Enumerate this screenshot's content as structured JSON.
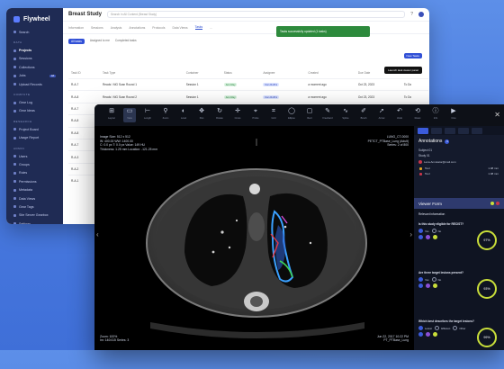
{
  "app": {
    "brand": "Flywheel",
    "study_title": "Breast Study",
    "search_placeholder": "Search in All Content (Breast Study)",
    "help": "?",
    "toast": "Tasks successfully updated (1 tasks)",
    "new_task_button": "New Tasks",
    "tooltip": "Launch task viewer panel"
  },
  "sidebar": {
    "items": [
      {
        "label": "Search"
      },
      {
        "section": "DATA"
      },
      {
        "label": "Projects",
        "active": true
      },
      {
        "label": "Sessions"
      },
      {
        "label": "Collections"
      },
      {
        "label": "Jobs",
        "badge": "18"
      },
      {
        "label": "Upload Records"
      },
      {
        "section": "COMPUTE"
      },
      {
        "label": "Gear Log"
      },
      {
        "label": "Gear Ideas"
      },
      {
        "section": "RESEARCH"
      },
      {
        "label": "Project Board"
      },
      {
        "label": "Usage Report"
      },
      {
        "section": "ADMIN"
      },
      {
        "label": "Users"
      },
      {
        "label": "Groups"
      },
      {
        "label": "Roles"
      },
      {
        "label": "Permissions"
      },
      {
        "label": "Metadata"
      },
      {
        "label": "Data Views"
      },
      {
        "label": "Gear Tags"
      },
      {
        "label": "Site Server Gearbox"
      },
      {
        "label": "Settings"
      }
    ]
  },
  "tabs": [
    "Information",
    "Sessions",
    "Analysis",
    "Annotations",
    "Protocols",
    "Data Views",
    "Tasks",
    "..."
  ],
  "active_tab": "Tasks",
  "subtabs": [
    "All tasks",
    "Assigned to me",
    "Completed tasks"
  ],
  "table": {
    "headers": [
      "Task ID",
      "Task Type",
      "Container",
      "Status",
      "Assignee",
      "Created",
      "Due Date",
      "Pro"
    ],
    "rows": [
      [
        "R-A-7",
        "Reads / MG Scan Round 1",
        "Session 1",
        "Ann Ray",
        "Dan Ruffini",
        "a moment ago",
        "Oct 23, 2023",
        "To Do"
      ],
      [
        "R-A-8",
        "Reads / MG Scan Round 2",
        "Session 1",
        "Ann Ray",
        "Dan Ruffini",
        "a moment ago",
        "Oct 23, 2023",
        "To Do"
      ],
      [
        "R-A-7",
        "",
        "",
        "",
        "",
        "",
        "",
        ""
      ],
      [
        "R-A-8",
        "",
        "",
        "",
        "",
        "",
        "",
        ""
      ],
      [
        "R-A-8",
        "",
        "",
        "",
        "",
        "",
        "",
        ""
      ],
      [
        "R-A-7",
        "",
        "",
        "",
        "",
        "",
        "",
        ""
      ],
      [
        "R-A-3",
        "",
        "",
        "",
        "",
        "",
        "",
        ""
      ],
      [
        "R-A-2",
        "",
        "",
        "",
        "",
        "",
        "",
        ""
      ],
      [
        "R-A-1",
        "",
        "",
        "",
        "",
        "",
        "",
        ""
      ]
    ]
  },
  "viewer": {
    "toolbar": [
      {
        "icon": "layout-icon",
        "glyph": "⊞",
        "label": "Layout"
      },
      {
        "icon": "view-icon",
        "glyph": "▭",
        "label": "View",
        "on": true
      },
      {
        "icon": "ruler-icon",
        "glyph": "⊢",
        "label": "Length"
      },
      {
        "icon": "zoom-icon",
        "glyph": "⚲",
        "label": "Zoom"
      },
      {
        "icon": "level-icon",
        "glyph": "◐",
        "label": "Level"
      },
      {
        "icon": "pan-icon",
        "glyph": "✥",
        "label": "Pan"
      },
      {
        "icon": "rotate-icon",
        "glyph": "↻",
        "label": "Rotate"
      },
      {
        "icon": "crosshair-icon",
        "glyph": "✛",
        "label": "Cross"
      },
      {
        "icon": "probe-icon",
        "glyph": "⌖",
        "label": "Probe"
      },
      {
        "icon": "grid-icon",
        "glyph": "⌗",
        "label": "Grid"
      },
      {
        "icon": "ellipse-icon",
        "glyph": "◯",
        "label": "Ellipse"
      },
      {
        "icon": "rect-icon",
        "glyph": "▢",
        "label": "Rect"
      },
      {
        "icon": "freehand-icon",
        "glyph": "✎",
        "label": "Freehand"
      },
      {
        "icon": "spline-icon",
        "glyph": "∿",
        "label": "Spline"
      },
      {
        "icon": "brush-icon",
        "glyph": "✐",
        "label": "Brush"
      },
      {
        "icon": "arrow-icon",
        "glyph": "➚",
        "label": "Arrow"
      },
      {
        "icon": "undo-icon",
        "glyph": "↶",
        "label": "Undo"
      },
      {
        "icon": "reset-icon",
        "glyph": "⟲",
        "label": "Reset"
      },
      {
        "icon": "info-icon",
        "glyph": "ⓘ",
        "label": "Info"
      },
      {
        "icon": "cine-icon",
        "glyph": "▶",
        "label": "Cine"
      }
    ],
    "overlay_tl": [
      "Image Size: 512 x 512",
      "W: 400.00 WW: 1400.00",
      "C: 0.0 px T: 0.0 px Value: 149 HU",
      "Thickness: 1.25 mm Location: -121.25 mm"
    ],
    "overlay_tr": [
      "LUNG_CT-0000",
      "PETCT_PTBase_Lung (Adult)",
      "Series: 2 of 800"
    ],
    "overlay_bl": [
      "Zoom: 100%",
      "Im: 140/415 Series: 3"
    ],
    "overlay_br": [
      "Jun 22, 2017 10:22 PM",
      "PT_PTBase_Lung"
    ]
  },
  "panel": {
    "title": "Annotations",
    "count": "3",
    "sub_items": [
      "Subject 01",
      "Study 01"
    ],
    "user": "Lena.Annotator@mail.com",
    "measurements": [
      {
        "label": "Tool",
        "value": "1.98 mm",
        "color": "#e0a21e"
      },
      {
        "label": "Tool",
        "value": "1.98 mm",
        "color": "#c8354a"
      }
    ],
    "form_title": "Viewer Form",
    "form_section": "Relevant information",
    "questions": [
      {
        "q": "Is this study eligible for RECIST?",
        "opts": [
          "Yes",
          "No"
        ],
        "score": "97%"
      },
      {
        "q": "Are there target lesions present?",
        "opts": [
          "Yes",
          "No"
        ],
        "score": "93%"
      },
      {
        "q": "Which best describes the target lesions?",
        "opts": [
          "Lesion",
          "Effusion",
          "Other"
        ],
        "score": "99%"
      }
    ]
  }
}
